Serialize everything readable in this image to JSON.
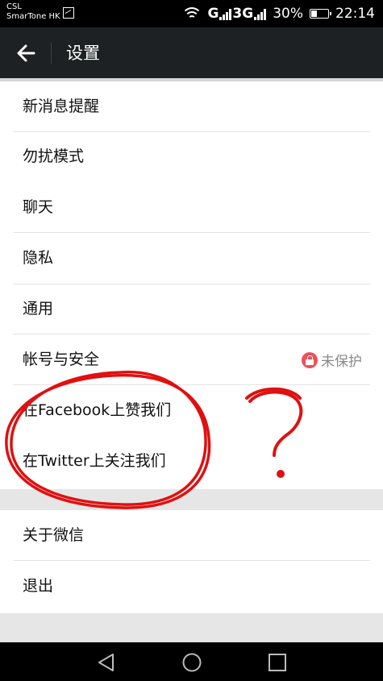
{
  "status_bar": {
    "carrier_line1": "CSL",
    "carrier_line2": "SmarTone HK",
    "network_1": "G",
    "network_2": "3G",
    "battery": "30%",
    "time": "22:14"
  },
  "app_bar": {
    "title": "设置",
    "back_icon": "arrow-left-icon"
  },
  "settings": {
    "items": [
      {
        "label": "新消息提醒"
      },
      {
        "label": "勿扰模式"
      },
      {
        "label": "聊天"
      },
      {
        "label": "隐私"
      },
      {
        "label": "通用"
      },
      {
        "label": "帐号与安全",
        "status": "未保护",
        "status_icon": "lock-icon"
      },
      {
        "label": "在Facebook上赞我们"
      },
      {
        "label": "在Twitter上关注我们"
      }
    ],
    "bottom_items": [
      {
        "label": "关于微信"
      },
      {
        "label": "退出"
      }
    ]
  },
  "annotation": {
    "color": "#e01010",
    "mark": "?"
  },
  "colors": {
    "app_bar": "#1d2124",
    "background": "#e6e6e6",
    "status_badge": "#e8525a"
  }
}
